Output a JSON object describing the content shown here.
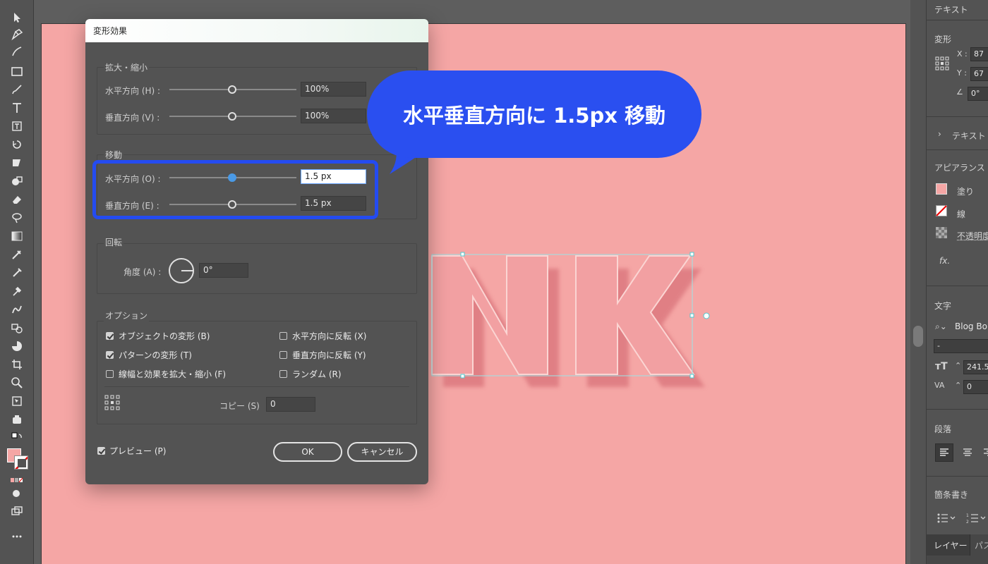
{
  "dialog": {
    "title": "変形効果",
    "scale": {
      "title": "拡大・縮小",
      "horizontal_label": "水平方向 (H) :",
      "horizontal_value": "100%",
      "vertical_label": "垂直方向 (V) :",
      "vertical_value": "100%"
    },
    "move": {
      "title": "移動",
      "horizontal_label": "水平方向 (O) :",
      "horizontal_value": "1.5 px",
      "vertical_label": "垂直方向 (E) :",
      "vertical_value": "1.5 px"
    },
    "rotate": {
      "title": "回転",
      "angle_label": "角度 (A) :",
      "angle_value": "0°"
    },
    "options": {
      "title": "オプション",
      "transform_objects": {
        "label": "オブジェクトの変形 (B)",
        "checked": true
      },
      "transform_patterns": {
        "label": "パターンの変形 (T)",
        "checked": true
      },
      "scale_strokes": {
        "label": "線幅と効果を拡大・縮小 (F)",
        "checked": false
      },
      "reflect_x": {
        "label": "水平方向に反転 (X)",
        "checked": false
      },
      "reflect_y": {
        "label": "垂直方向に反転 (Y)",
        "checked": false
      },
      "random": {
        "label": "ランダム (R)",
        "checked": false
      },
      "copies_label": "コピー (S)",
      "copies_value": "0"
    },
    "preview": {
      "label": "プレビュー (P)",
      "checked": true
    },
    "ok_label": "OK",
    "cancel_label": "キャンセル"
  },
  "callout": {
    "text": "水平垂直方向に 1.5px 移動",
    "color": "#2a4ff0"
  },
  "right_panel": {
    "header": "テキスト",
    "transform": {
      "title": "変形",
      "x_label": "X :",
      "x_value": "87",
      "y_label": "Y :",
      "y_value": "67",
      "angle_value": "0°"
    },
    "text_section": "テキスト",
    "appearance": {
      "title": "アピアランス",
      "fill_label": "塗り",
      "stroke_label": "線",
      "opacity_label": "不透明度",
      "fx_label": "fx."
    },
    "character": {
      "title": "文字",
      "font_name": "Blog Bo",
      "font_style": "-",
      "font_size": "241.5",
      "tracking": "0"
    },
    "paragraph": {
      "title": "段落"
    },
    "bullets": {
      "title": "箇条書き"
    },
    "tabs": [
      "レイヤー",
      "パス"
    ]
  },
  "colors": {
    "artboard": "#f5a6a5",
    "highlight": "#244bf0",
    "accent_slider": "#4a9ae6"
  }
}
